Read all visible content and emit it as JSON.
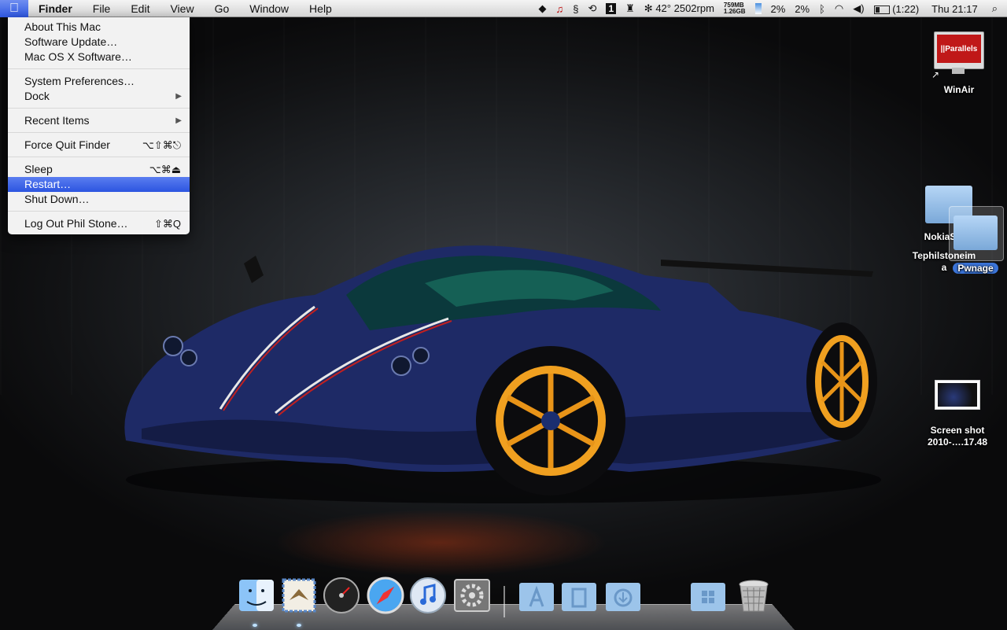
{
  "menubar": {
    "apple_icon": "apple-logo",
    "items": [
      "Finder",
      "File",
      "Edit",
      "View",
      "Go",
      "Window",
      "Help"
    ],
    "status": {
      "temperature": "42°",
      "fan": "2502rpm",
      "memory_top": "759MB",
      "memory_bottom": "1.26GB",
      "cpu1": "2%",
      "cpu2": "2%",
      "battery_time": "(1:22)",
      "clock": "Thu 21:17",
      "space_number": "1",
      "icons": [
        "dropbox-icon",
        "evernote-icon",
        "script-icon",
        "time-machine-icon",
        "spaces-icon",
        "castle-icon",
        "activity-icon",
        "bluetooth-icon",
        "wifi-icon",
        "volume-icon",
        "battery-icon",
        "spotlight-icon"
      ]
    }
  },
  "apple_menu": {
    "items": [
      {
        "label": "About This Mac",
        "shortcut": ""
      },
      {
        "label": "Software Update…",
        "shortcut": ""
      },
      {
        "label": "Mac OS X Software…",
        "shortcut": ""
      },
      {
        "label": "System Preferences…",
        "shortcut": ""
      },
      {
        "label": "Dock",
        "shortcut": "▶"
      },
      {
        "label": "Recent Items",
        "shortcut": "▶"
      },
      {
        "label": "Force Quit Finder",
        "shortcut": "⌥⇧⌘⎋"
      },
      {
        "label": "Sleep",
        "shortcut": "⌥⌘⏏"
      },
      {
        "label": "Restart…",
        "shortcut": ""
      },
      {
        "label": "Shut Down…",
        "shortcut": ""
      },
      {
        "label": "Log Out Phil Stone…",
        "shortcut": "⇧⌘Q"
      }
    ],
    "selected": "Restart…"
  },
  "desktop": {
    "icons": [
      {
        "label": "WinAir",
        "badge": "||Parallels"
      },
      {
        "label_line1": "NokiaSM",
        "label_line2": "Tephilstoneim",
        "label_line3": "a"
      },
      {
        "label": "Pwnage"
      },
      {
        "label_line1": "Screen shot",
        "label_line2": "2010-….17.48"
      }
    ]
  },
  "dock": {
    "apps": [
      "finder-icon",
      "mail-icon",
      "dashboard-icon",
      "safari-icon",
      "itunes-icon",
      "system-preferences-icon"
    ],
    "stacks": [
      "applications-folder-icon",
      "documents-folder-icon",
      "downloads-folder-icon",
      "windows-folder-icon",
      "trash-icon"
    ]
  },
  "colors": {
    "selection": "#2c55e0",
    "menubar": "#e8e8e8",
    "car_body": "#1f2d6a",
    "wheels": "#f0a020"
  }
}
